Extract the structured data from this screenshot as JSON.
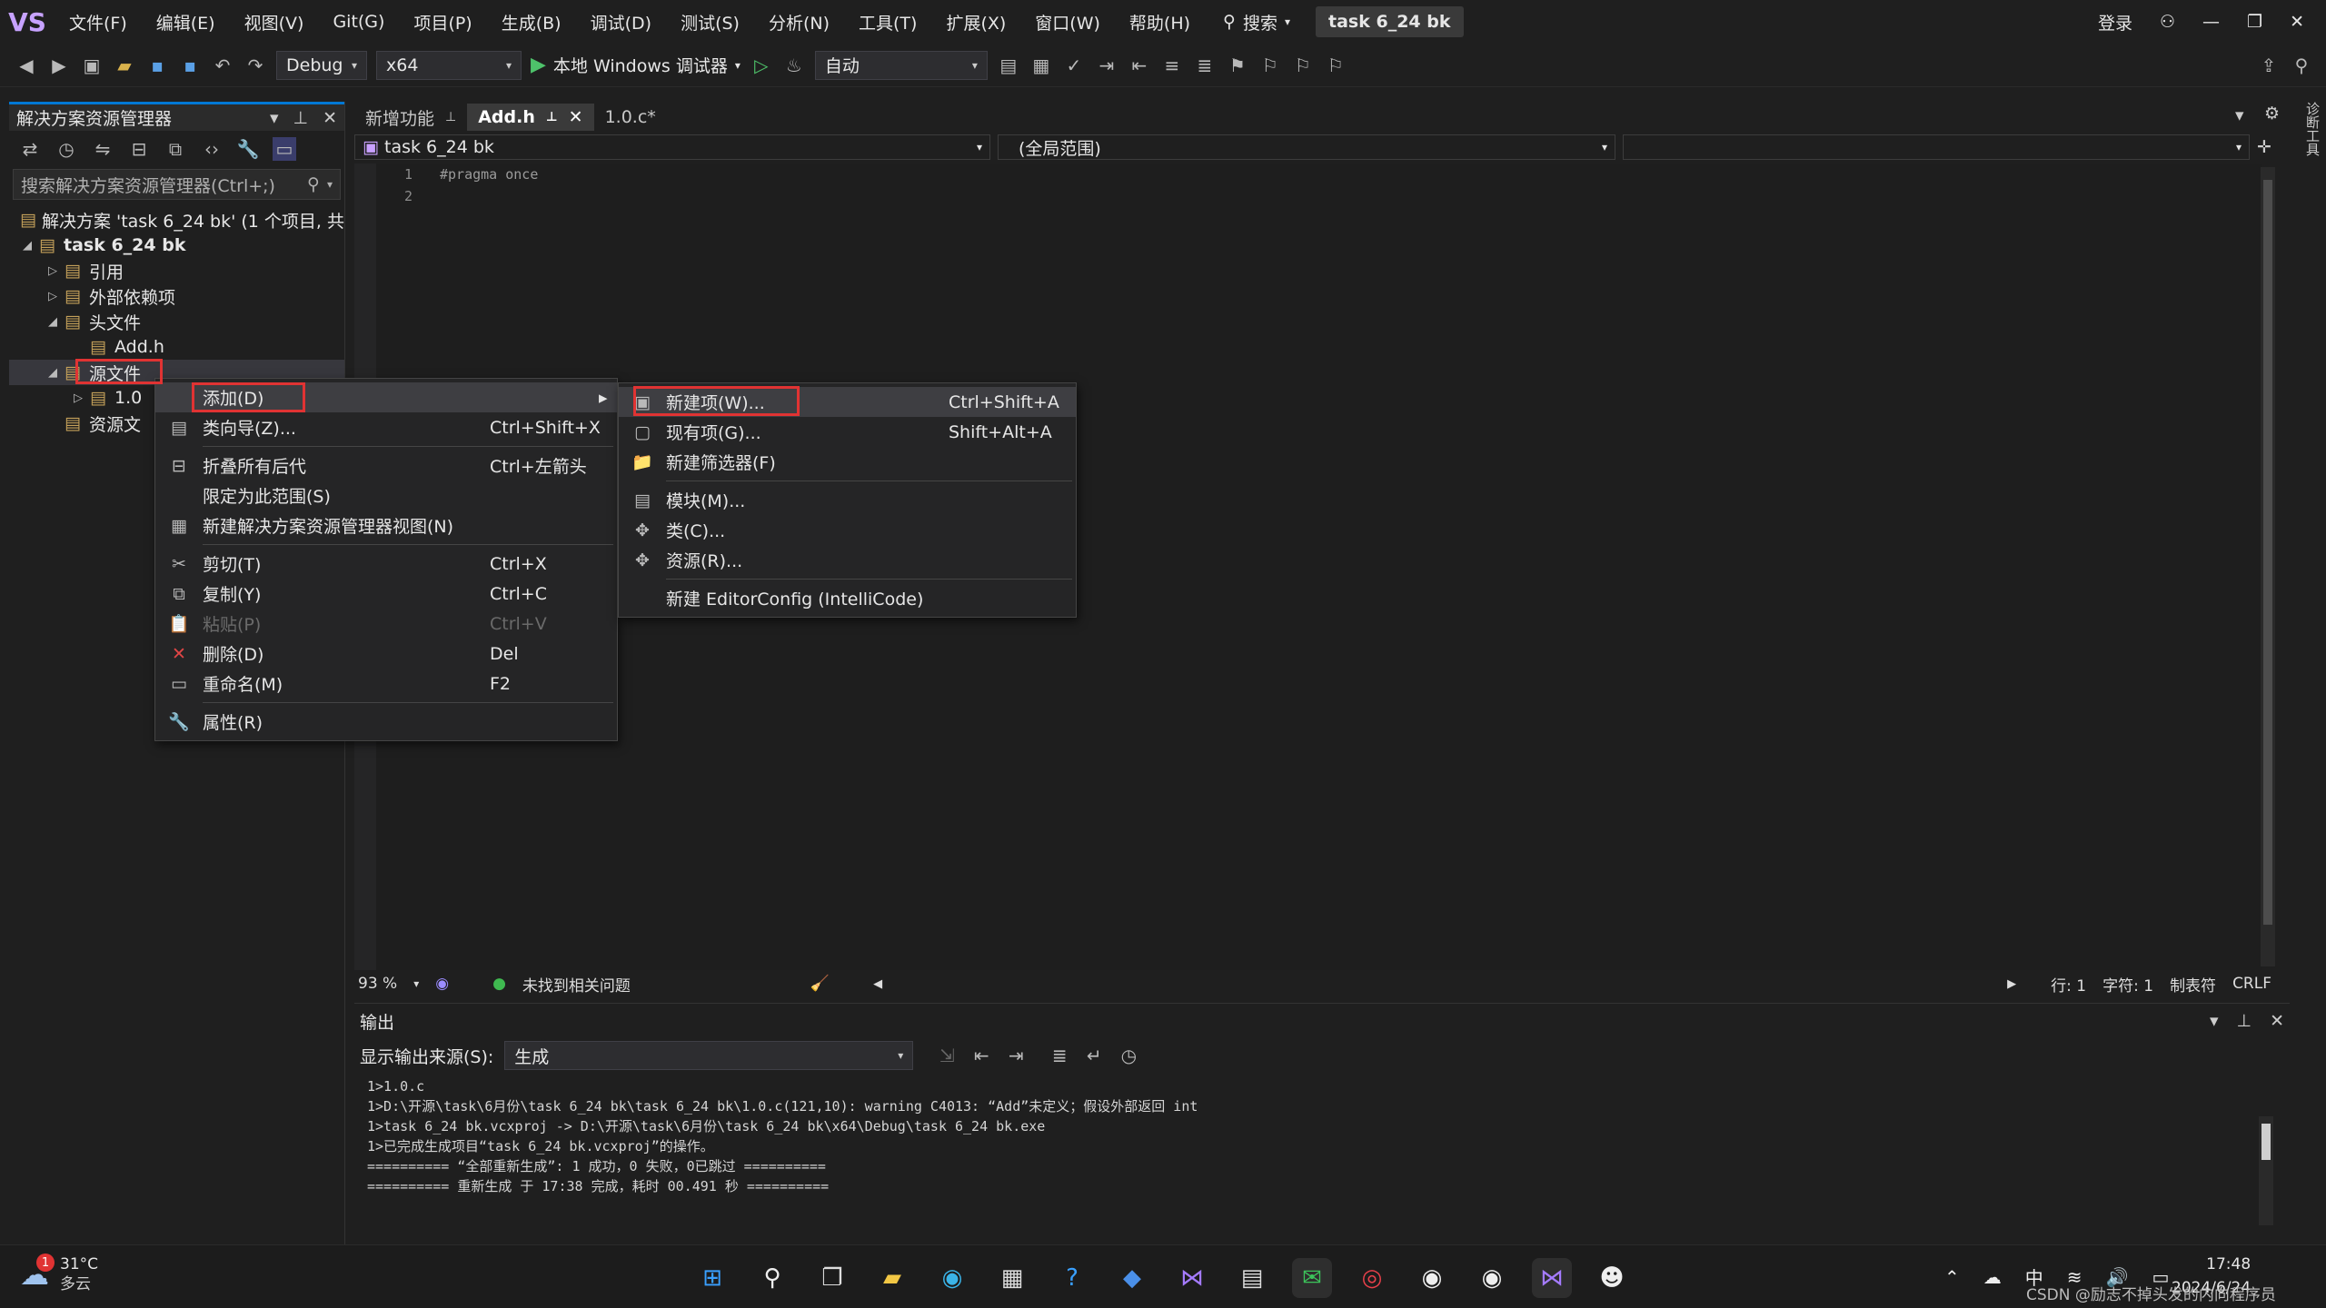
{
  "app": {
    "logo": "VS",
    "solution_name": "task 6_24 bk"
  },
  "menubar": {
    "items": [
      "文件(F)",
      "编辑(E)",
      "视图(V)",
      "Git(G)",
      "项目(P)",
      "生成(B)",
      "调试(D)",
      "测试(S)",
      "分析(N)",
      "工具(T)",
      "扩展(X)",
      "窗口(W)",
      "帮助(H)"
    ],
    "search_label": "搜索",
    "login_label": "登录"
  },
  "toolbar": {
    "config": "Debug",
    "platform": "x64",
    "run_label": "本地 Windows 调试器",
    "auto_combo": "自动"
  },
  "solution_explorer": {
    "title": "解决方案资源管理器",
    "search_placeholder": "搜索解决方案资源管理器(Ctrl+;)",
    "tree": [
      {
        "label": "解决方案 'task 6_24 bk' (1 个项目, 共",
        "indent": 0,
        "exp": ""
      },
      {
        "label": "task 6_24 bk",
        "indent": 0,
        "exp": "◢",
        "bold": true
      },
      {
        "label": "引用",
        "indent": 1,
        "exp": "▷"
      },
      {
        "label": "外部依赖项",
        "indent": 1,
        "exp": "▷"
      },
      {
        "label": "头文件",
        "indent": 1,
        "exp": "◢"
      },
      {
        "label": "Add.h",
        "indent": 2,
        "exp": ""
      },
      {
        "label": "源文件",
        "indent": 1,
        "exp": "◢",
        "selected": true
      },
      {
        "label": "1.0",
        "indent": 2,
        "exp": "▷"
      },
      {
        "label": "资源文",
        "indent": 1,
        "exp": ""
      }
    ]
  },
  "editor": {
    "tabs": [
      {
        "label": "新增功能",
        "active": false
      },
      {
        "label": "Add.h",
        "active": true
      },
      {
        "label": "1.0.c*",
        "active": false
      }
    ],
    "nav_project": "task 6_24 bk",
    "nav_scope": "(全局范围)",
    "lines": [
      {
        "num": "1",
        "text": "#pragma once"
      },
      {
        "num": "2",
        "text": ""
      }
    ],
    "zoom": "93 %",
    "issues": "未找到相关问题",
    "row": "行: 1",
    "col": "字符: 1",
    "tab_mode": "制表符",
    "eol": "CRLF"
  },
  "output": {
    "title": "输出",
    "source_label": "显示输出来源(S):",
    "source_value": "生成",
    "text": "1>1.0.c\n1>D:\\开源\\task\\6月份\\task 6_24 bk\\task 6_24 bk\\1.0.c(121,10): warning C4013: “Add”未定义；假设外部返回 int\n1>task 6_24 bk.vcxproj -> D:\\开源\\task\\6月份\\task 6_24 bk\\x64\\Debug\\task 6_24 bk.exe\n1>已完成生成项目“task 6_24 bk.vcxproj”的操作。\n========== “全部重新生成”: 1 成功，0 失败，0已跳过 ==========\n========== 重新生成 于 17:38 完成，耗时 00.491 秒 =========="
  },
  "context_menu": {
    "items": [
      {
        "label": "添加(D)",
        "shortcut": "",
        "icon": "",
        "submenu": true
      },
      {
        "label": "类向导(Z)...",
        "shortcut": "Ctrl+Shift+X",
        "icon": "▤"
      },
      {
        "sep": true
      },
      {
        "label": "折叠所有后代",
        "shortcut": "Ctrl+左箭头",
        "icon": "⊟"
      },
      {
        "label": "限定为此范围(S)",
        "shortcut": "",
        "icon": ""
      },
      {
        "label": "新建解决方案资源管理器视图(N)",
        "shortcut": "",
        "icon": "▦"
      },
      {
        "sep": true
      },
      {
        "label": "剪切(T)",
        "shortcut": "Ctrl+X",
        "icon": "✂"
      },
      {
        "label": "复制(Y)",
        "shortcut": "Ctrl+C",
        "icon": "⧉"
      },
      {
        "label": "粘贴(P)",
        "shortcut": "Ctrl+V",
        "icon": "📋",
        "disabled": true
      },
      {
        "label": "删除(D)",
        "shortcut": "Del",
        "icon": "✕",
        "icon_color": "#e04646"
      },
      {
        "label": "重命名(M)",
        "shortcut": "F2",
        "icon": "▭"
      },
      {
        "sep": true
      },
      {
        "label": "属性(R)",
        "shortcut": "",
        "icon": "🔧"
      }
    ]
  },
  "submenu": {
    "items": [
      {
        "label": "新建项(W)...",
        "shortcut": "Ctrl+Shift+A",
        "icon": "▣"
      },
      {
        "label": "现有项(G)...",
        "shortcut": "Shift+Alt+A",
        "icon": "▢"
      },
      {
        "label": "新建筛选器(F)",
        "shortcut": "",
        "icon": "📁"
      },
      {
        "sep": true
      },
      {
        "label": "模块(M)...",
        "shortcut": "",
        "icon": "▤"
      },
      {
        "label": "类(C)...",
        "shortcut": "",
        "icon": "✥"
      },
      {
        "label": "资源(R)...",
        "shortcut": "",
        "icon": "✥"
      },
      {
        "sep": true
      },
      {
        "label": "新建 EditorConfig (IntelliCode)",
        "shortcut": "",
        "icon": ""
      }
    ]
  },
  "taskbar": {
    "weather_temp": "31°C",
    "weather_desc": "多云",
    "weather_badge": "1",
    "ime": "中",
    "time": "17:48",
    "date": "2024/6/24",
    "watermark": "CSDN @励志不掉头发的内向程序员"
  }
}
